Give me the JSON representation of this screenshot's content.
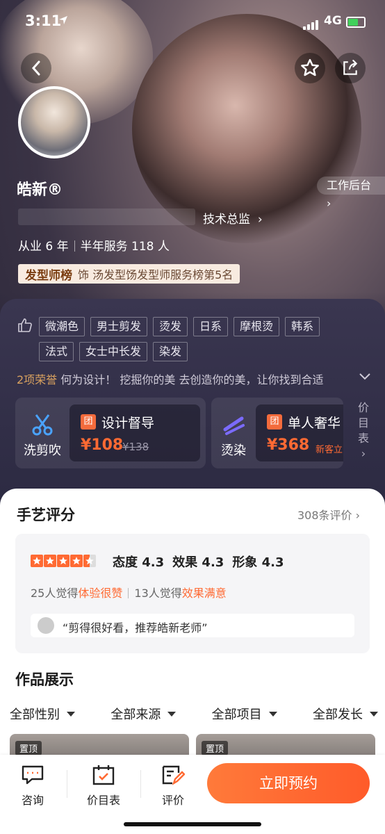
{
  "status": {
    "time": "3:11",
    "network": "4G"
  },
  "profile": {
    "name": "皓新®",
    "workbench": "工作后台",
    "title": "技术总监",
    "years": "从业 6 年",
    "served": "半年服务 118 人",
    "rank_tag": "发型师榜",
    "rank_text": "饰 汤发型饧发型师服务榜第5名"
  },
  "tags": [
    "微潮色",
    "男士剪发",
    "烫发",
    "日系",
    "摩根烫",
    "韩系",
    "法式",
    "女士中长发",
    "染发"
  ],
  "honor": {
    "count": "2项荣誉",
    "text": "何为设计！ 挖掘你的美 去创造你的美，让你找到合适"
  },
  "services": [
    {
      "label": "洗剪吹",
      "icon": "scissors-icon",
      "tuan": "团",
      "title": "设计督导",
      "price": "¥108",
      "original": "¥138",
      "new": ""
    },
    {
      "label": "烫染",
      "icon": "curling-iron-icon",
      "tuan": "团",
      "title": "单人奢华",
      "price": "¥368",
      "original": "",
      "new": "新客立"
    }
  ],
  "price_list": "价目表",
  "reviews": {
    "heading": "手艺评分",
    "count": "308条评价",
    "rating_stars": 4.5,
    "attitude": "态度 4.3",
    "effect": "效果 4.3",
    "image": "形象 4.3",
    "feel1_prefix": "25人觉得",
    "feel1_hl": "体验很赞",
    "feel2_prefix": "13人觉得",
    "feel2_hl": "效果满意",
    "quote": "“剪得很好看，推荐皓新老师”"
  },
  "works": {
    "heading": "作品展示",
    "filters": [
      "全部性别",
      "全部来源",
      "全部项目",
      "全部发长"
    ],
    "pin": "置顶"
  },
  "tabbar": {
    "consult": "咨询",
    "prices": "价目表",
    "review": "评价",
    "book": "立即预约"
  },
  "colors": {
    "accent": "#ff6a33",
    "panel": "#2c2a42"
  }
}
